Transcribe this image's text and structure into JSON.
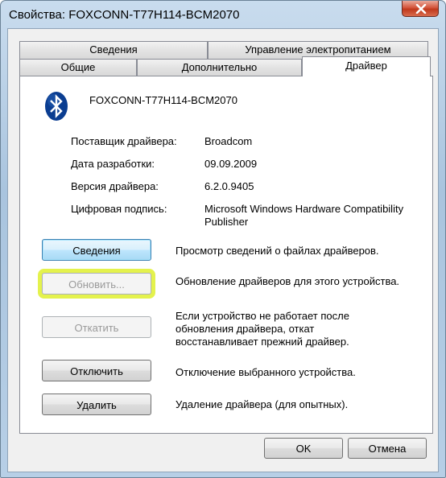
{
  "window": {
    "title": "Свойства: FOXCONN-T77H114-BCM2070"
  },
  "tabs": {
    "row1": [
      {
        "label": "Сведения"
      },
      {
        "label": "Управление электропитанием"
      }
    ],
    "row2": [
      {
        "label": "Общие"
      },
      {
        "label": "Дополнительно"
      },
      {
        "label": "Драйвер",
        "active": true
      }
    ]
  },
  "device": {
    "icon": "bluetooth-icon",
    "name": "FOXCONN-T77H114-BCM2070"
  },
  "properties": [
    {
      "label": "Поставщик драйвера:",
      "value": "Broadcom"
    },
    {
      "label": "Дата разработки:",
      "value": "09.09.2009"
    },
    {
      "label": "Версия драйвера:",
      "value": "6.2.0.9405"
    },
    {
      "label": "Цифровая подпись:",
      "value": "Microsoft Windows Hardware Compatibility Publisher"
    }
  ],
  "actions": [
    {
      "button": "Сведения",
      "description": "Просмотр сведений о файлах драйверов.",
      "state": "focused"
    },
    {
      "button": "Обновить...",
      "description": "Обновление драйверов для этого устройства.",
      "state": "highlighted"
    },
    {
      "button": "Откатить",
      "description_lines": [
        "Если устройство не работает после",
        "обновления драйвера, откат",
        "восстанавливает прежний драйвер."
      ],
      "state": "disabled"
    },
    {
      "button": "Отключить",
      "description": "Отключение выбранного устройства.",
      "state": "normal"
    },
    {
      "button": "Удалить",
      "description": "Удаление драйвера (для опытных).",
      "state": "normal"
    }
  ],
  "footer": {
    "ok": "OK",
    "cancel": "Отмена"
  },
  "colors": {
    "highlight": "#e4f24d",
    "bluetooth": "#0a3d91"
  }
}
